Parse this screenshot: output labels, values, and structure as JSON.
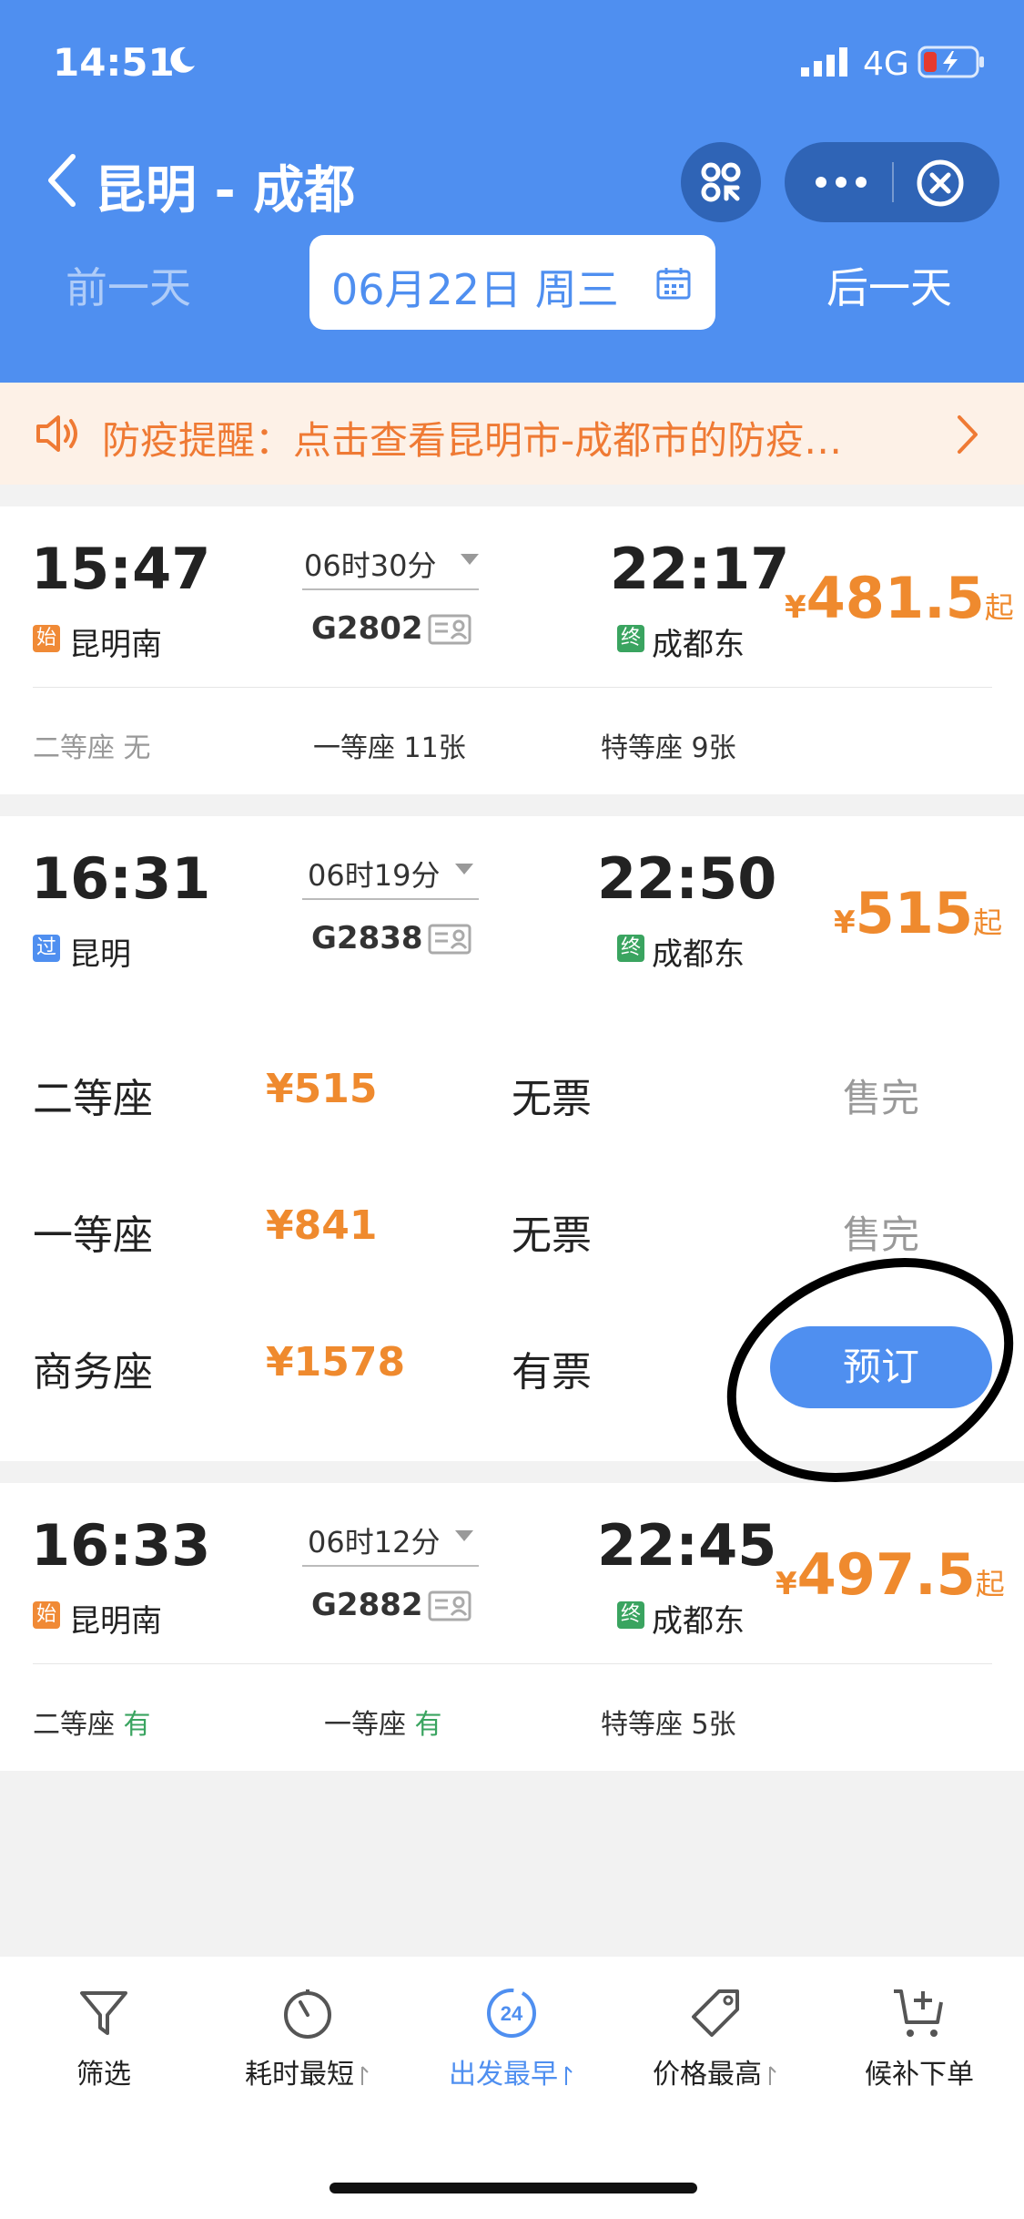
{
  "status_bar": {
    "time": "14:51",
    "network": "4G"
  },
  "header": {
    "title": "昆明 - 成都",
    "prev_day": "前一天",
    "next_day": "后一天",
    "date": "06月22日 周三"
  },
  "notice": {
    "text": "防疫提醒：点击查看昆明市-成都市的防疫…"
  },
  "trains": [
    {
      "dep_time": "15:47",
      "dep_badge": "始",
      "dep_station": "昆明南",
      "duration": "06时30分",
      "train_no": "G2802",
      "arr_time": "22:17",
      "arr_badge": "终",
      "arr_station": "成都东",
      "price_symbol": "¥",
      "price": "481.5",
      "price_suffix": "起",
      "seats": [
        {
          "name": "二等座",
          "avail": "无"
        },
        {
          "name": "一等座",
          "avail": "11张"
        },
        {
          "name": "特等座",
          "avail": "9张"
        }
      ]
    },
    {
      "dep_time": "16:31",
      "dep_badge": "过",
      "dep_station": "昆明",
      "duration": "06时19分",
      "train_no": "G2838",
      "arr_time": "22:50",
      "arr_badge": "终",
      "arr_station": "成都东",
      "price_symbol": "¥",
      "price": "515",
      "price_suffix": "起",
      "expanded_seats": [
        {
          "name": "二等座",
          "price": "¥515",
          "status": "无票",
          "action": "售完"
        },
        {
          "name": "一等座",
          "price": "¥841",
          "status": "无票",
          "action": "售完"
        },
        {
          "name": "商务座",
          "price": "¥1578",
          "status": "有票",
          "action": "预订"
        }
      ]
    },
    {
      "dep_time": "16:33",
      "dep_badge": "始",
      "dep_station": "昆明南",
      "duration": "06时12分",
      "train_no": "G2882",
      "arr_time": "22:45",
      "arr_badge": "终",
      "arr_station": "成都东",
      "price_symbol": "¥",
      "price": "497.5",
      "price_suffix": "起",
      "seats": [
        {
          "name": "二等座",
          "avail": "有"
        },
        {
          "name": "一等座",
          "avail": "有"
        },
        {
          "name": "特等座",
          "avail": "5张"
        }
      ]
    }
  ],
  "bottom_tabs": [
    {
      "label": "筛选",
      "icon": "filter-icon"
    },
    {
      "label": "耗时最短",
      "icon": "timer-icon"
    },
    {
      "label": "出发最早",
      "icon": "clock-24-icon",
      "active": true
    },
    {
      "label": "价格最高",
      "icon": "price-tag-icon"
    },
    {
      "label": "候补下单",
      "icon": "cart-add-icon"
    }
  ],
  "colors": {
    "primary": "#4f8ff0",
    "price": "#ef8a2e",
    "notice": "#ef7a34",
    "green": "#3aa460"
  }
}
